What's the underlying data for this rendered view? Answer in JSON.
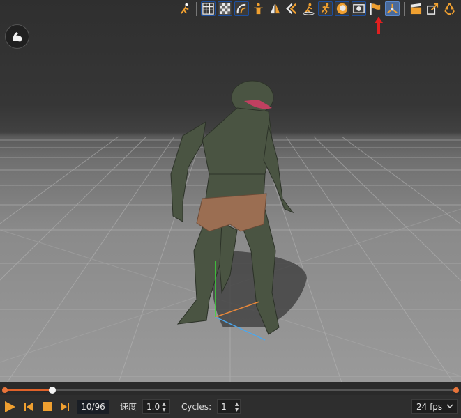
{
  "toolbar": {
    "icons": [
      "walk-pose-icon",
      "grid-icon",
      "checker-grid-icon",
      "undo-curve-icon",
      "character-icon",
      "mirror-icon",
      "step-back-icon",
      "motion-path-icon",
      "run-icon",
      "circle-gizmo-icon",
      "camera-frame-icon",
      "flag-icon",
      "axis-gizmo-icon",
      "clapper-icon",
      "export-icon",
      "recycle-icon"
    ]
  },
  "timeline": {
    "progress": 0.105
  },
  "controls": {
    "frame": "10/96",
    "speed_label": "速度",
    "speed_value": "1.0",
    "cycles_label": "Cycles:",
    "cycles_value": "1",
    "fps_value": "24 fps"
  },
  "colors": {
    "accent": "#f0a030",
    "highlight": "#4a6a9a",
    "timeline": "#e0622a",
    "arrow": "#e02020"
  }
}
